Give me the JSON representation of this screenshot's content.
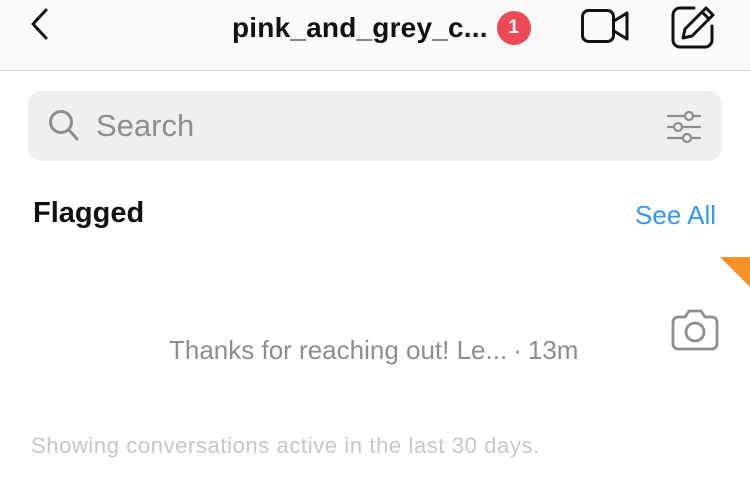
{
  "header": {
    "back_icon": "chevron-left-icon",
    "account_name": "pink_and_grey_c...",
    "notification_count": "1",
    "badge_color": "#ed4956",
    "video_icon": "video-camera-icon",
    "compose_icon": "compose-icon"
  },
  "search": {
    "placeholder": "Search",
    "search_icon": "search-icon",
    "filter_icon": "filter-icon"
  },
  "flagged_section": {
    "title": "Flagged",
    "see_all_label": "See All",
    "link_color": "#3897f0",
    "flag_color": "#f5902a",
    "threads": [
      {
        "preview": "Thanks for reaching out! Le...",
        "separator": "·",
        "time": "13m",
        "action_icon": "camera-icon"
      }
    ]
  },
  "footer": {
    "note": "Showing conversations active in the last 30 days."
  }
}
